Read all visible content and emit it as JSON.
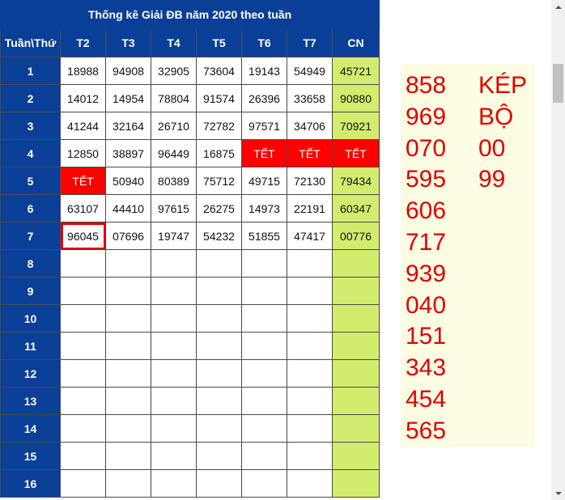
{
  "table": {
    "title": "Thống kê Giải ĐB năm 2020 theo tuần",
    "headers": [
      "Tuần\\Thứ",
      "T2",
      "T3",
      "T4",
      "T5",
      "T6",
      "T7",
      "CN"
    ],
    "rows": [
      {
        "week": "1",
        "cells": [
          "18988",
          "94908",
          "32905",
          "73604",
          "19143",
          "54949",
          "45721"
        ]
      },
      {
        "week": "2",
        "cells": [
          "14012",
          "14954",
          "78804",
          "91574",
          "26396",
          "33658",
          "90880"
        ]
      },
      {
        "week": "3",
        "cells": [
          "41244",
          "32164",
          "26710",
          "72782",
          "97571",
          "34706",
          "70921"
        ]
      },
      {
        "week": "4",
        "cells": [
          "12850",
          "38897",
          "96449",
          "16875",
          "TẾT",
          "TẾT",
          "TẾT"
        ]
      },
      {
        "week": "5",
        "cells": [
          "TẾT",
          "50940",
          "80389",
          "75712",
          "49715",
          "72130",
          "79434"
        ]
      },
      {
        "week": "6",
        "cells": [
          "63107",
          "44410",
          "97615",
          "26275",
          "14973",
          "22191",
          "60347"
        ]
      },
      {
        "week": "7",
        "cells": [
          "96045",
          "07696",
          "19747",
          "54232",
          "51855",
          "47417",
          "00776"
        ]
      },
      {
        "week": "8",
        "cells": [
          "",
          "",
          "",
          "",
          "",
          "",
          ""
        ]
      },
      {
        "week": "9",
        "cells": [
          "",
          "",
          "",
          "",
          "",
          "",
          ""
        ]
      },
      {
        "week": "10",
        "cells": [
          "",
          "",
          "",
          "",
          "",
          "",
          ""
        ]
      },
      {
        "week": "11",
        "cells": [
          "",
          "",
          "",
          "",
          "",
          "",
          ""
        ]
      },
      {
        "week": "12",
        "cells": [
          "",
          "",
          "",
          "",
          "",
          "",
          ""
        ]
      },
      {
        "week": "13",
        "cells": [
          "",
          "",
          "",
          "",
          "",
          "",
          ""
        ]
      },
      {
        "week": "14",
        "cells": [
          "",
          "",
          "",
          "",
          "",
          "",
          ""
        ]
      },
      {
        "week": "15",
        "cells": [
          "",
          "",
          "",
          "",
          "",
          "",
          ""
        ]
      },
      {
        "week": "16",
        "cells": [
          "",
          "",
          "",
          "",
          "",
          "",
          ""
        ]
      }
    ],
    "tet_label": "TẾT",
    "highlighted_cell": "96045"
  },
  "side_panel": {
    "left_column": [
      "858",
      "969",
      "070",
      "595",
      "606",
      "717",
      "939",
      "040",
      "151",
      "343",
      "454",
      "565"
    ],
    "right_column": [
      "KÉP",
      "BỘ",
      "00",
      "99"
    ]
  },
  "colors": {
    "header_blue": "#0a3f98",
    "sunday_green": "#d3ec6e",
    "tet_red": "#ff0000",
    "highlight_red": "#e00000",
    "side_text_red": "#e00000",
    "side_panel_bg": "#fdfde3"
  },
  "icons": {
    "scroll_up": "triangle-up-icon",
    "scroll_down": "triangle-down-icon"
  }
}
